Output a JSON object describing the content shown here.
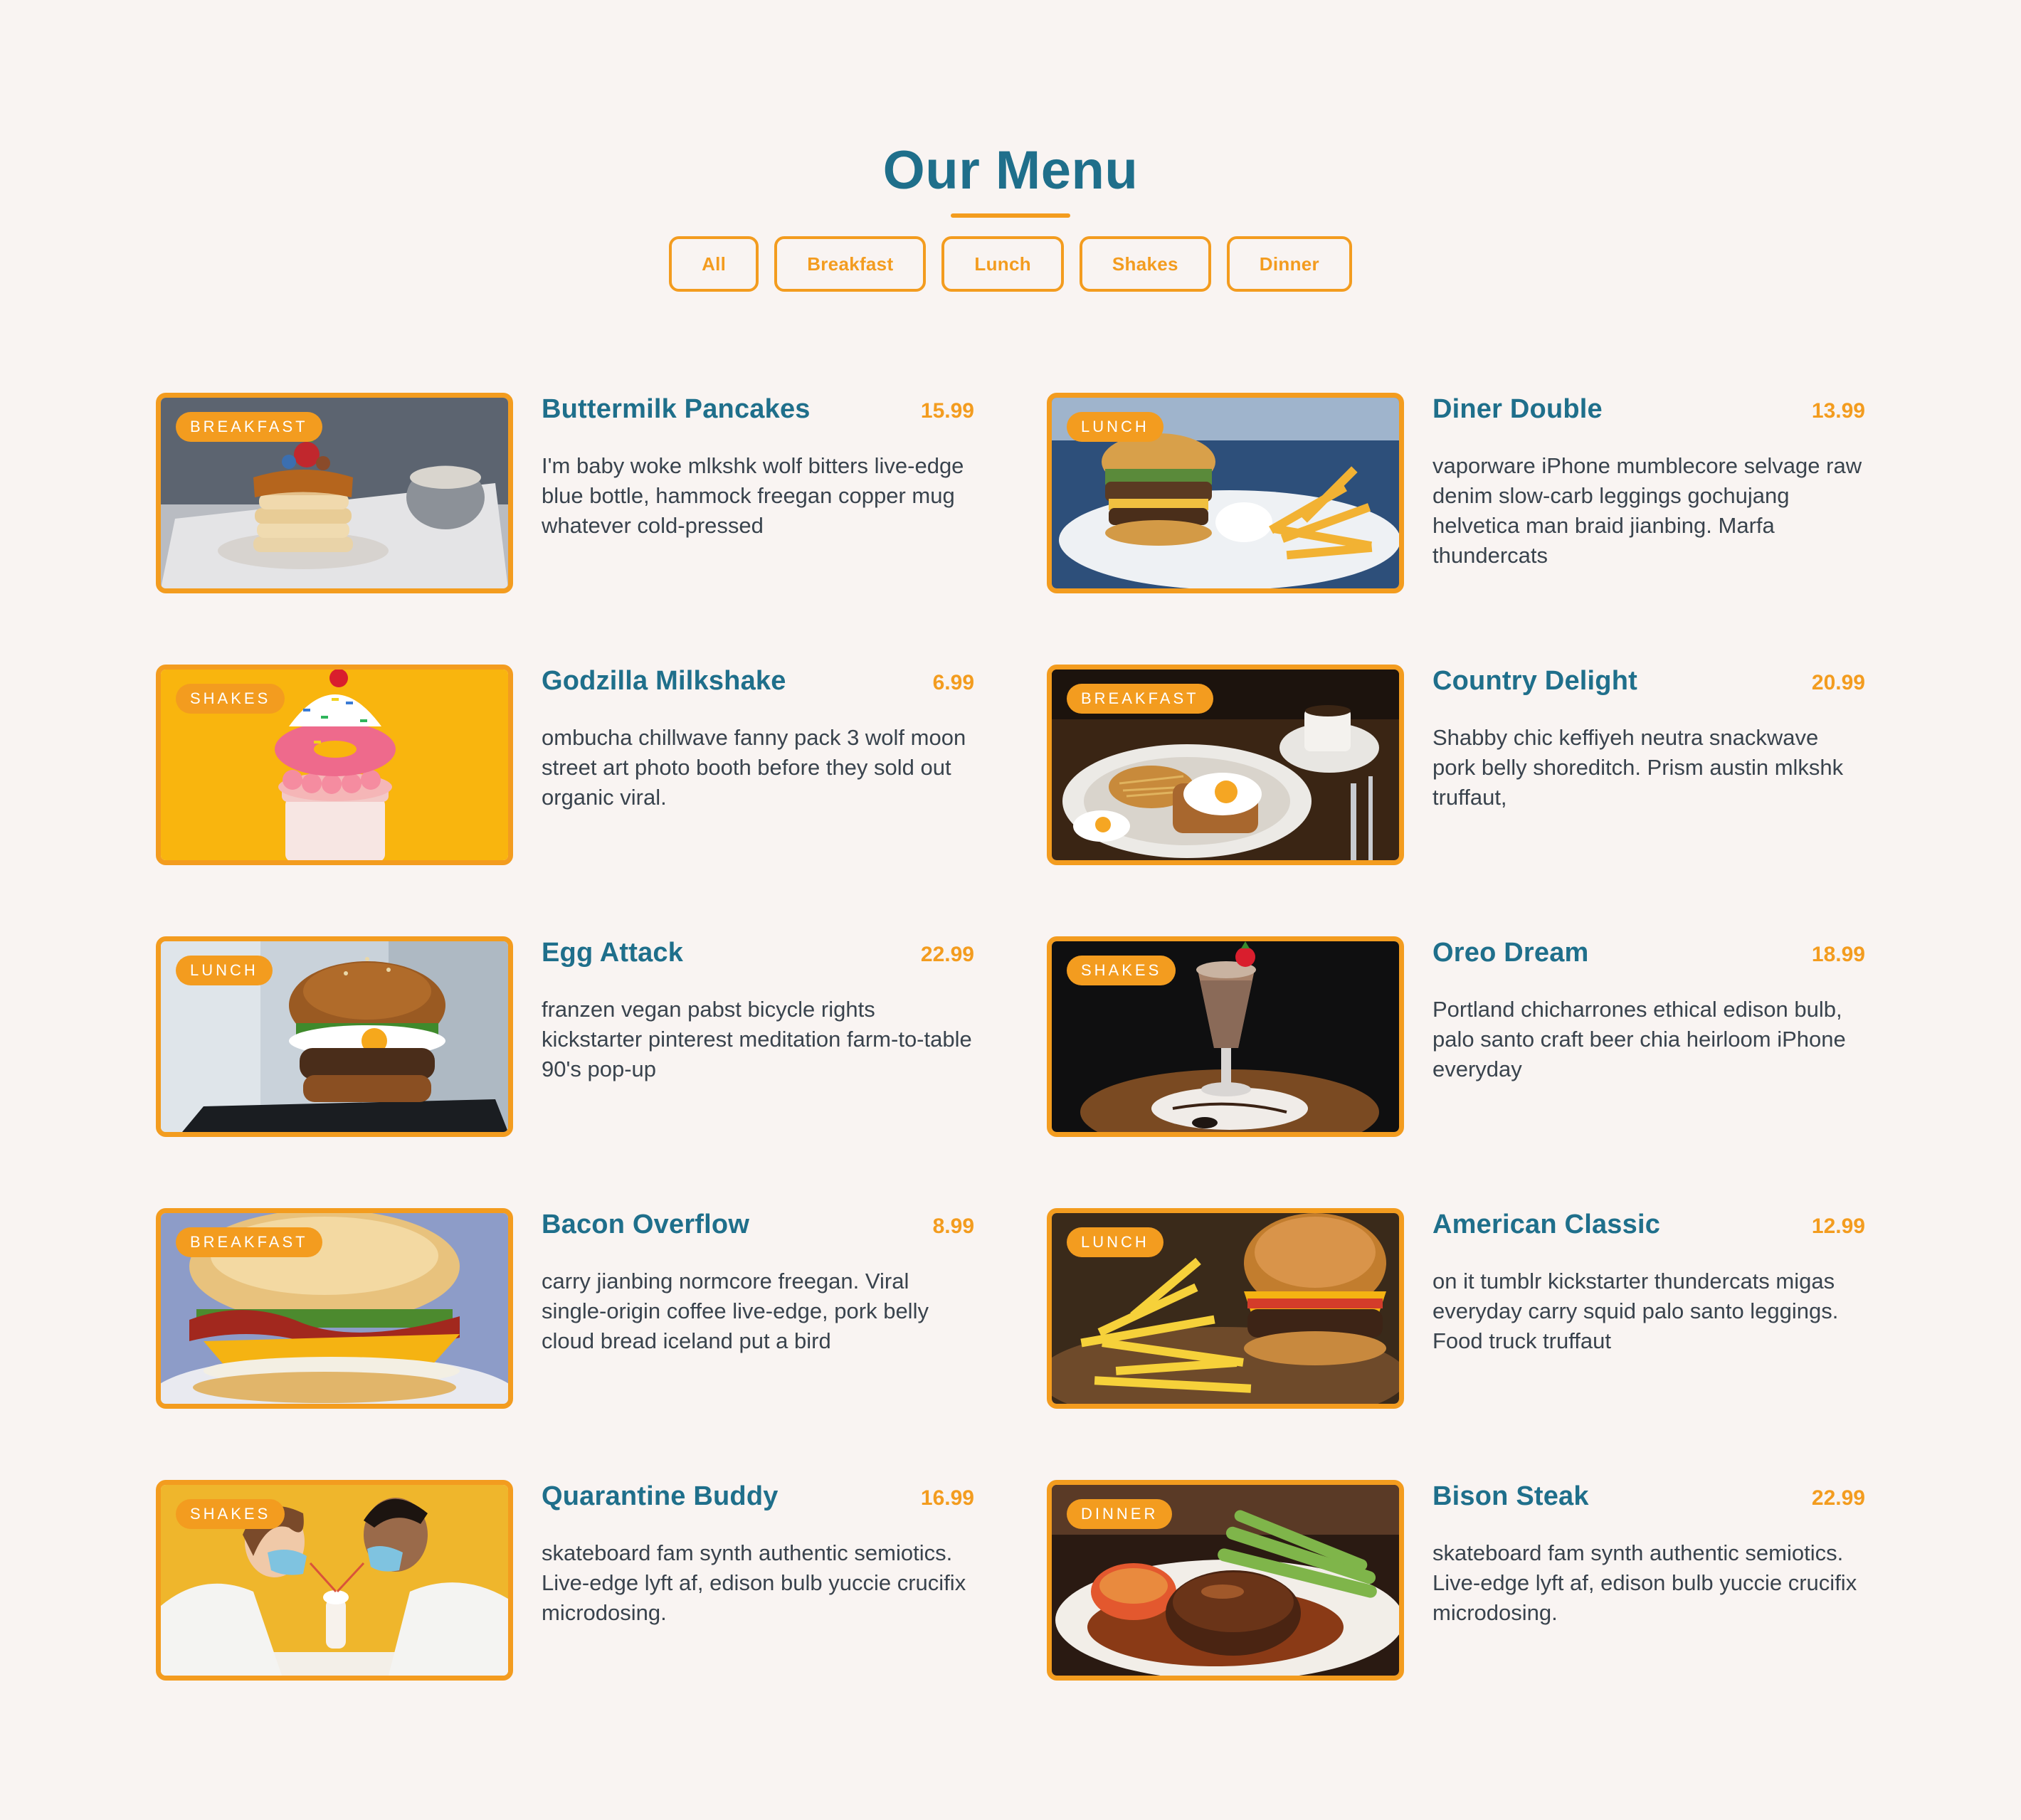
{
  "header": {
    "title": "Our Menu"
  },
  "filters": [
    "All",
    "Breakfast",
    "Lunch",
    "Shakes",
    "Dinner"
  ],
  "items": [
    {
      "name": "Buttermilk Pancakes",
      "price": "15.99",
      "category": "BREAKFAST",
      "desc": "I'm baby woke mlkshk wolf bitters live-edge blue bottle, hammock freegan copper mug whatever cold-pressed"
    },
    {
      "name": "Diner Double",
      "price": "13.99",
      "category": "LUNCH",
      "desc": "vaporware iPhone mumblecore selvage raw denim slow-carb leggings gochujang helvetica man braid jianbing. Marfa thundercats"
    },
    {
      "name": "Godzilla Milkshake",
      "price": "6.99",
      "category": "SHAKES",
      "desc": "ombucha chillwave fanny pack 3 wolf moon street art photo booth before they sold out organic viral."
    },
    {
      "name": "Country Delight",
      "price": "20.99",
      "category": "BREAKFAST",
      "desc": "Shabby chic keffiyeh neutra snackwave pork belly shoreditch. Prism austin mlkshk truffaut,"
    },
    {
      "name": "Egg Attack",
      "price": "22.99",
      "category": "LUNCH",
      "desc": "franzen vegan pabst bicycle rights kickstarter pinterest meditation farm-to-table 90's pop-up"
    },
    {
      "name": "Oreo Dream",
      "price": "18.99",
      "category": "SHAKES",
      "desc": "Portland chicharrones ethical edison bulb, palo santo craft beer chia heirloom iPhone everyday"
    },
    {
      "name": "Bacon Overflow",
      "price": "8.99",
      "category": "BREAKFAST",
      "desc": "carry jianbing normcore freegan. Viral single-origin coffee live-edge, pork belly cloud bread iceland put a bird"
    },
    {
      "name": "American Classic",
      "price": "12.99",
      "category": "LUNCH",
      "desc": "on it tumblr kickstarter thundercats migas everyday carry squid palo santo leggings. Food truck truffaut"
    },
    {
      "name": "Quarantine Buddy",
      "price": "16.99",
      "category": "SHAKES",
      "desc": "skateboard fam synth authentic semiotics. Live-edge lyft af, edison bulb yuccie crucifix microdosing."
    },
    {
      "name": "Bison Steak",
      "price": "22.99",
      "category": "DINNER",
      "desc": "skateboard fam synth authentic semiotics. Live-edge lyft af, edison bulb yuccie crucifix microdosing."
    }
  ],
  "colors": {
    "accent": "#f39c1f",
    "heading": "#1f6f8b",
    "background": "#f9f4f2",
    "text": "#39434d"
  }
}
